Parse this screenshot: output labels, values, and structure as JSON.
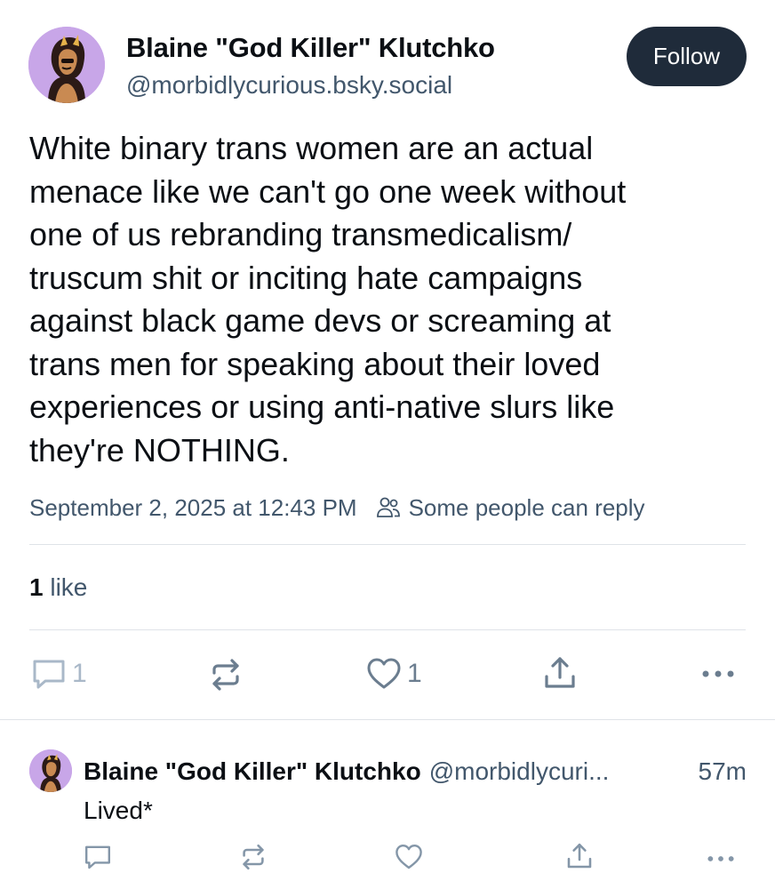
{
  "post": {
    "author": {
      "display_name": "Blaine \"God Killer\" Klutchko",
      "handle": "@morbidlycurious.bsky.social",
      "avatar_icon": "avatar-icon"
    },
    "follow_label": "Follow",
    "text_lines": [
      "White binary trans women are an actual",
      "menace like we can't go one week without",
      "one of us rebranding transmedicalism/",
      "truscum shit or inciting hate campaigns",
      "against black game devs or screaming at",
      "trans men for speaking about their loved",
      "experiences or using anti-native slurs like",
      "they're NOTHING."
    ],
    "timestamp": "September 2, 2025 at 12:43 PM",
    "reply_restriction": "Some people can reply",
    "likes": {
      "count": "1",
      "label": "like"
    },
    "actions": {
      "reply_count": "1",
      "repost_count": "",
      "like_count": "1"
    }
  },
  "reply": {
    "display_name": "Blaine \"God Killer\" Klutchko",
    "handle": "@morbidlycuri...",
    "time": "57m",
    "text": "Lived*"
  },
  "colors": {
    "text_primary": "#0b0f14",
    "text_secondary": "#42576c",
    "icon_muted": "#6b7d8f",
    "follow_button_bg": "#1f2b3a",
    "divider": "#dfe3e8",
    "avatar_bg": "#c8a6e8"
  }
}
